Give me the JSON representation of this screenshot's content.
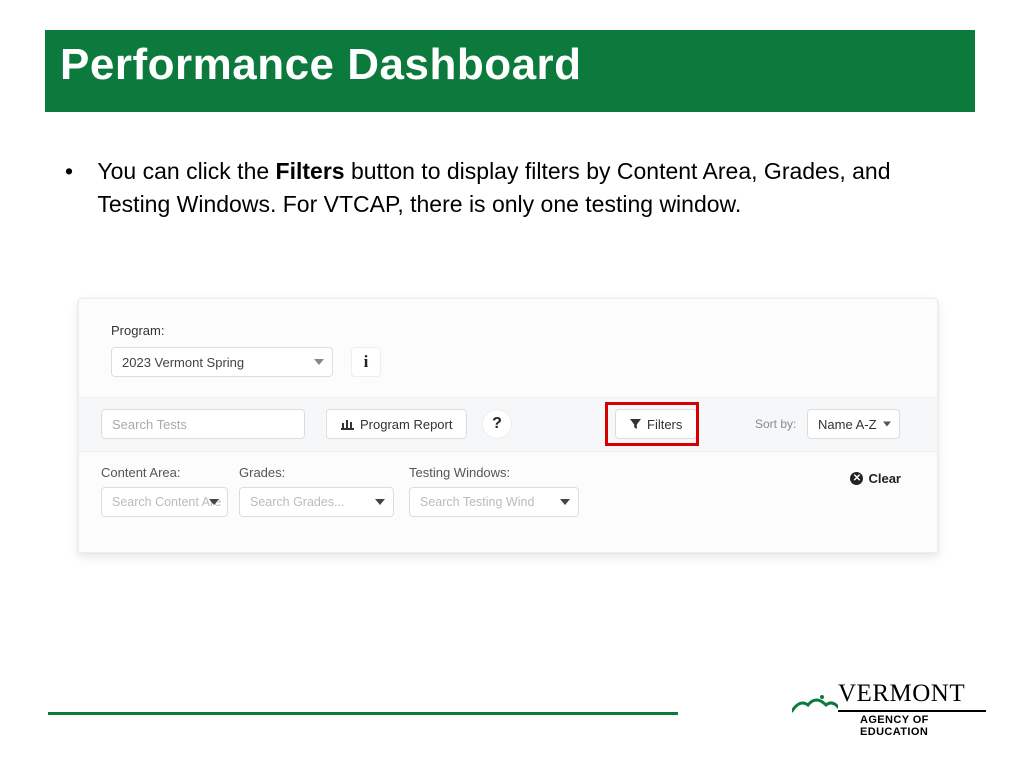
{
  "title": "Performance Dashboard",
  "bullet": {
    "prefix": "You can click the ",
    "strong": "Filters",
    "suffix": " button to display filters by Content Area, Grades, and Testing Windows. For VTCAP, there is only one testing window."
  },
  "panel": {
    "program_label": "Program:",
    "program_value": "2023 Vermont Spring",
    "search_placeholder": "Search Tests",
    "program_report_label": "Program Report",
    "filters_label": "Filters",
    "sort_label": "Sort by:",
    "sort_value": "Name A-Z",
    "content_area_label": "Content Area:",
    "content_area_placeholder": "Search Content Are",
    "grades_label": "Grades:",
    "grades_placeholder": "Search Grades...",
    "testing_windows_label": "Testing Windows:",
    "testing_windows_placeholder": "Search Testing Wind",
    "clear_label": "Clear",
    "info_glyph": "i",
    "help_glyph": "?"
  },
  "footer": {
    "brand": "VERMONT",
    "subbrand": "AGENCY OF EDUCATION"
  }
}
